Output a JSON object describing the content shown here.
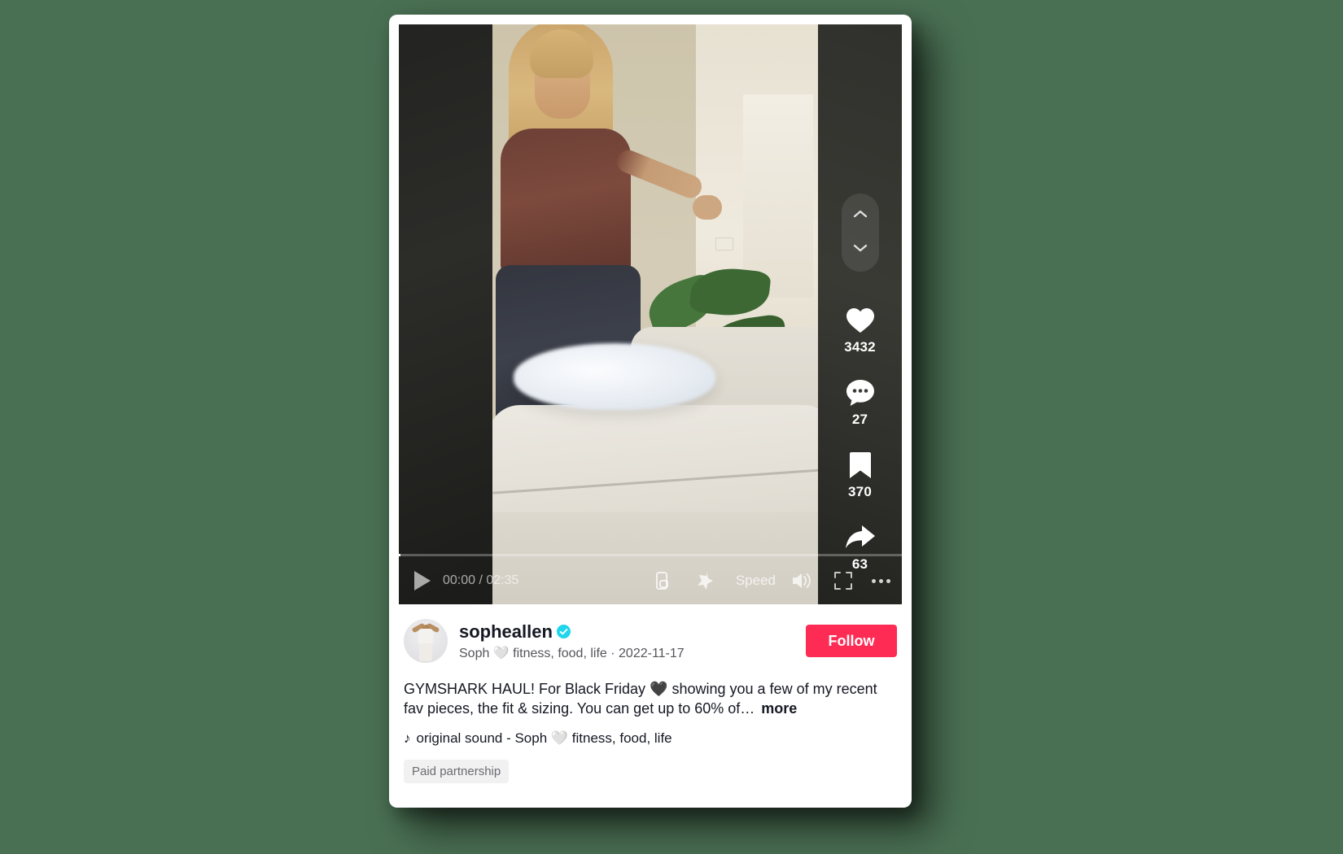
{
  "theme": {
    "background": "#4A7053",
    "accent": "#FE2C55",
    "verified_blue": "#20D5EC",
    "text_primary": "#161823"
  },
  "player": {
    "progress_percent": 0,
    "play_icon": "play-icon",
    "current_time": "00:00",
    "separator": "/",
    "total_time": "02:35",
    "time_display": "00:00 / 02:35",
    "controls": [
      {
        "name": "picture-in-picture-icon",
        "label": ""
      },
      {
        "name": "auto-scroll-icon",
        "label": ""
      },
      {
        "name": "speed-button",
        "label": "Speed"
      },
      {
        "name": "volume-icon",
        "label": ""
      },
      {
        "name": "fullscreen-icon",
        "label": ""
      },
      {
        "name": "more-options-icon",
        "label": ""
      }
    ]
  },
  "rail": {
    "nav_up": "chevron-up-icon",
    "nav_down": "chevron-down-icon",
    "actions": [
      {
        "icon": "heart-icon",
        "name": "like-button",
        "count": "3432"
      },
      {
        "icon": "comment-icon",
        "name": "comment-button",
        "count": "27"
      },
      {
        "icon": "bookmark-icon",
        "name": "bookmark-button",
        "count": "370"
      },
      {
        "icon": "share-icon",
        "name": "share-button",
        "count": "63"
      }
    ]
  },
  "post": {
    "username": "sopheallen",
    "verified": true,
    "subtitle": "Soph 🤍 fitness, food, life · 2022-11-17",
    "date": "2022-11-17",
    "follow_label": "Follow",
    "caption": "GYMSHARK HAUL! For Black Friday 🖤 showing you a few of my recent fav pieces, the fit & sizing. You can get up to 60% of…",
    "more_label": "more",
    "music_icon": "music-note-icon",
    "music": "original sound - Soph 🤍 fitness, food, life",
    "paid_partnership_label": "Paid partnership"
  }
}
